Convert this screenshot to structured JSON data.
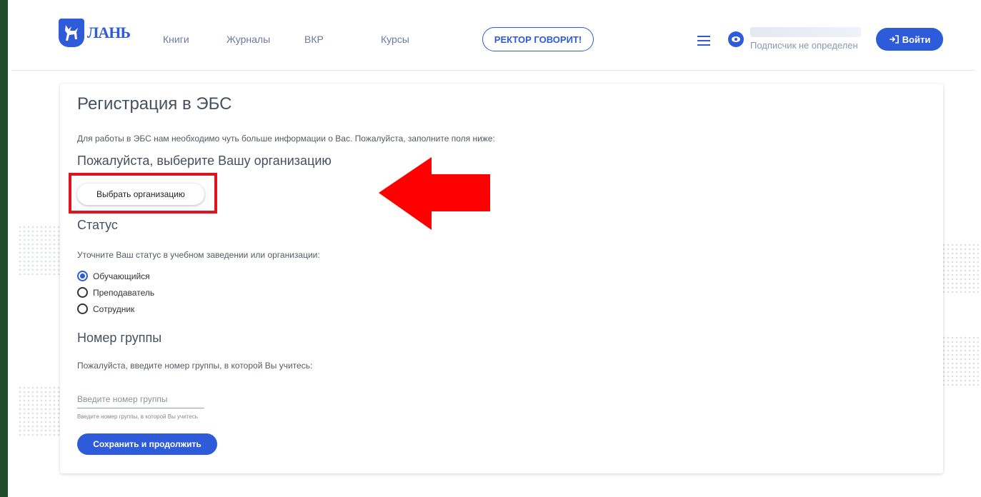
{
  "header": {
    "logo_text": "ЛАНЬ",
    "nav": [
      "Книги",
      "Журналы",
      "ВКР",
      "Курсы"
    ],
    "rector_button": "РЕКТОР ГОВОРИТ!",
    "subscriber_text": "Подписчик не определен",
    "login_button": "Войти"
  },
  "form": {
    "title": "Регистрация в ЭБС",
    "intro": "Для работы в ЭБС нам необходимо чуть больше информации о Вас. Пожалуйста, заполните поля ниже:",
    "org_heading": "Пожалуйста, выберите Вашу организацию",
    "org_button": "Выбрать организацию",
    "status_heading": "Статус",
    "status_prompt": "Уточните Ваш статус в учебном заведении или организации:",
    "status_options": [
      {
        "label": "Обучающийся",
        "selected": true
      },
      {
        "label": "Преподаватель",
        "selected": false
      },
      {
        "label": "Сотрудник",
        "selected": false
      }
    ],
    "group_heading": "Номер группы",
    "group_prompt": "Пожалуйста, введите номер группы, в которой Вы учитесь:",
    "group_input_value": "",
    "group_input_placeholder": "Введите номер группы",
    "group_hint": "Введите номер группы, в которой Вы учитесь",
    "save_button": "Сохранить и продолжить"
  },
  "colors": {
    "accent": "#2e5bd9",
    "highlight_red": "#e0141e",
    "arrow_red": "#ff0000",
    "background_green": "#1f4d2a"
  }
}
